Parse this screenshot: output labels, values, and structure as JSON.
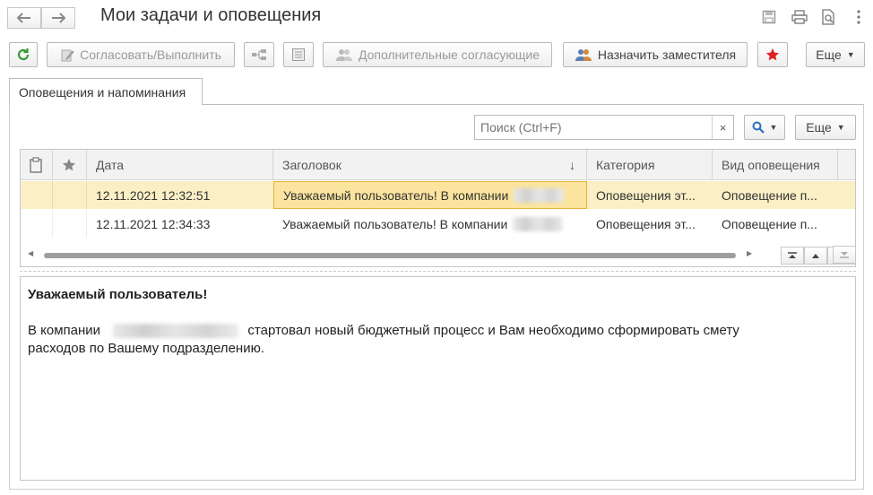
{
  "window": {
    "title": "Мои задачи и оповещения",
    "icons": [
      "back-arrow-icon",
      "forward-arrow-icon",
      "save-icon",
      "print-icon",
      "preview-icon",
      "more-vertical-icon"
    ]
  },
  "toolbar": {
    "approve_label": "Согласовать/Выполнить",
    "additional_label": "Дополнительные согласующие",
    "deputy_label": "Назначить заместителя",
    "more_label": "Еще"
  },
  "tab": {
    "label": "Оповещения и напоминания"
  },
  "search": {
    "placeholder": "Поиск (Ctrl+F)",
    "clear": "×",
    "more_label": "Еще"
  },
  "table": {
    "columns": {
      "date": "Дата",
      "subject": "Заголовок",
      "sort": "↓",
      "category": "Категория",
      "type": "Вид оповещения"
    },
    "rows": [
      {
        "date": "12.11.2021 12:32:51",
        "subject": "Уважаемый пользователь!  В компании",
        "category": "Оповещения эт...",
        "type": "Оповещение п..."
      },
      {
        "date": "12.11.2021 12:34:33",
        "subject": "Уважаемый пользователь!  В компании",
        "category": "Оповещения эт...",
        "type": "Оповещение п..."
      }
    ]
  },
  "message": {
    "heading": "Уважаемый пользователь!",
    "line1_prefix": "В компании",
    "line1_suffix": "стартовал новый бюджетный процесс и Вам необходимо сформировать смету",
    "line2": "расходов по Вашему подразделению."
  },
  "colors": {
    "selected_row": "#fbefc6",
    "focus_cell": "#fbe49e",
    "refresh_green": "#3a9a3a",
    "star_red": "#e02020",
    "search_blue": "#2a6fbf"
  }
}
